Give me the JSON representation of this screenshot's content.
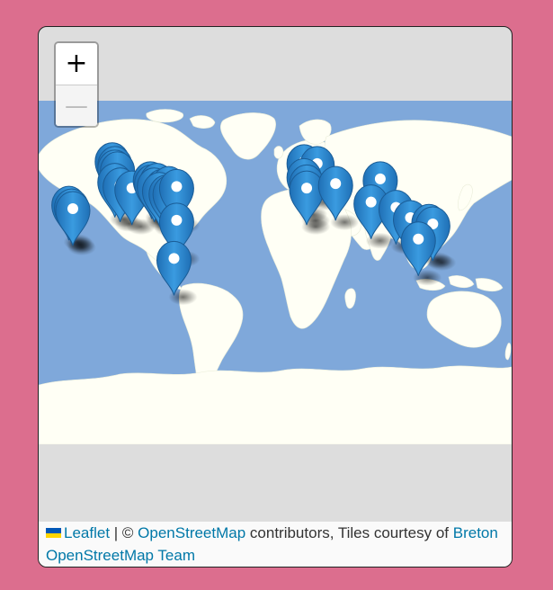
{
  "map": {
    "zoom_in_label": "+",
    "zoom_out_label": "—",
    "colors": {
      "ocean": "#7fa8da",
      "land": "#fffff5",
      "marker": "#2a86cf",
      "frame_background": "#dc6e8e"
    },
    "markers": [
      {
        "lat": 49,
        "lon": -124
      },
      {
        "lat": 47,
        "lon": -122
      },
      {
        "lat": 45,
        "lon": -122
      },
      {
        "lat": 44,
        "lon": -120
      },
      {
        "lat": 37,
        "lon": -122
      },
      {
        "lat": 34,
        "lon": -118
      },
      {
        "lat": 21,
        "lon": -157
      },
      {
        "lat": 19,
        "lon": -155
      },
      {
        "lat": 17,
        "lon": -154
      },
      {
        "lat": 32,
        "lon": -109
      },
      {
        "lat": 38,
        "lon": -95
      },
      {
        "lat": 36,
        "lon": -94
      },
      {
        "lat": 37,
        "lon": -90
      },
      {
        "lat": 34,
        "lon": -92
      },
      {
        "lat": 33,
        "lon": -86
      },
      {
        "lat": 35,
        "lon": -81
      },
      {
        "lat": 31,
        "lon": -88
      },
      {
        "lat": 29,
        "lon": -83
      },
      {
        "lat": 29,
        "lon": -80
      },
      {
        "lat": 33,
        "lon": -75
      },
      {
        "lat": 8,
        "lon": -75
      },
      {
        "lat": -22,
        "lon": -77
      },
      {
        "lat": 48,
        "lon": 22
      },
      {
        "lat": 47,
        "lon": 32
      },
      {
        "lat": 40,
        "lon": 22
      },
      {
        "lat": 36,
        "lon": 24
      },
      {
        "lat": 32,
        "lon": 24
      },
      {
        "lat": 35,
        "lon": 46
      },
      {
        "lat": 38,
        "lon": 80
      },
      {
        "lat": 22,
        "lon": 73
      },
      {
        "lat": 18,
        "lon": 92
      },
      {
        "lat": 10,
        "lon": 103
      },
      {
        "lat": 7,
        "lon": 117
      },
      {
        "lat": 5,
        "lon": 120
      },
      {
        "lat": -7,
        "lon": 109
      }
    ]
  },
  "attribution": {
    "leaflet": "Leaflet",
    "separator": " | © ",
    "osm": "OpenStreetMap",
    "contributors": " contributors, Tiles courtesy of ",
    "breton": "Breton OpenStreetMap Team"
  }
}
